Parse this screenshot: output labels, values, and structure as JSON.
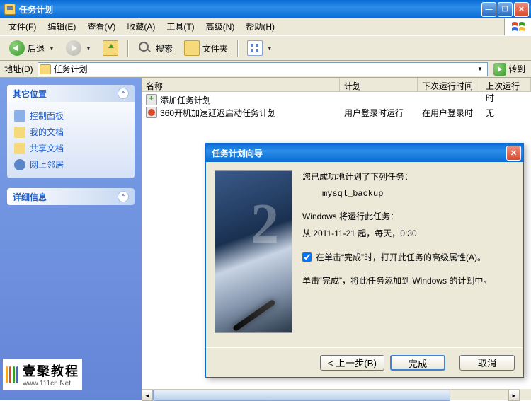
{
  "window": {
    "title": "任务计划"
  },
  "menu": {
    "file": "文件(F)",
    "edit": "编辑(E)",
    "view": "查看(V)",
    "favorites": "收藏(A)",
    "tools": "工具(T)",
    "advanced": "高级(N)",
    "help": "帮助(H)"
  },
  "toolbar": {
    "back": "后退",
    "search": "搜索",
    "folders": "文件夹"
  },
  "addressbar": {
    "label": "地址(D)",
    "value": "任务计划",
    "go": "转到"
  },
  "sidebar": {
    "panel1": {
      "title": "其它位置",
      "items": [
        "控制面板",
        "我的文档",
        "共享文档",
        "网上邻居"
      ]
    },
    "panel2": {
      "title": "详细信息"
    }
  },
  "list": {
    "columns": {
      "name": "名称",
      "plan": "计划",
      "next": "下次运行时间",
      "last": "上次运行时"
    },
    "rows": [
      {
        "name": "添加任务计划",
        "plan": "",
        "next": "",
        "last": ""
      },
      {
        "name": "360开机加速延迟启动任务计划",
        "plan": "用户登录时运行",
        "next": "在用户登录时",
        "last": "无"
      }
    ]
  },
  "dialog": {
    "title": "任务计划向导",
    "line1": "您已成功地计划了下列任务：",
    "task_name": "mysql_backup",
    "line2": "Windows 将运行此任务：",
    "schedule": "从 2011-11-21 起，每天，0:30",
    "checkbox": "在单击“完成”时，打开此任务的高级属性(A)。",
    "line3": "单击“完成”，将此任务添加到 Windows 的计划中。",
    "buttons": {
      "back": "< 上一步(B)",
      "finish": "完成",
      "cancel": "取消"
    }
  },
  "watermark": {
    "text": "壹聚教程",
    "url": "www.111cn.Net"
  }
}
